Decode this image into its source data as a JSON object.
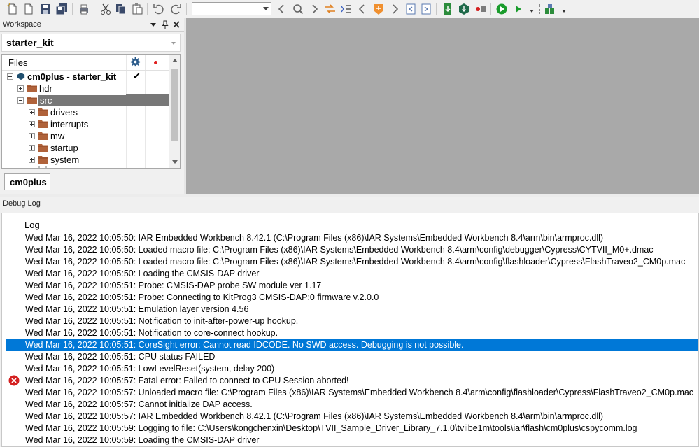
{
  "toolbar": {
    "icons": [
      "new-file-icon",
      "open-file-icon",
      "save-icon",
      "save-all-icon",
      "print-icon",
      "cut-icon",
      "copy-icon",
      "paste-icon",
      "undo-icon",
      "redo-icon",
      "find-back-icon",
      "find-icon",
      "find-forward-icon",
      "toggle-bookmark-icon",
      "go-to-icon",
      "navigate-back-icon",
      "bookmark-icon",
      "navigate-forward-icon",
      "compile-icon",
      "make-icon",
      "stop-build-icon",
      "breakpoint-icon",
      "download-debug-icon",
      "debug-no-download-icon",
      "layout-icon"
    ],
    "search_value": ""
  },
  "workspace": {
    "title": "Workspace",
    "project": "starter_kit",
    "files_header": "Files",
    "tree": [
      {
        "label": "cm0plus - starter_kit",
        "level": 0,
        "kind": "project",
        "bold": true,
        "check": "✔",
        "expander": "minus"
      },
      {
        "label": "hdr",
        "level": 1,
        "kind": "folder",
        "expander": "plus"
      },
      {
        "label": "src",
        "level": 1,
        "kind": "folder",
        "expander": "minus",
        "selected": true
      },
      {
        "label": "drivers",
        "level": 2,
        "kind": "folder",
        "expander": "plus"
      },
      {
        "label": "interrupts",
        "level": 2,
        "kind": "folder",
        "expander": "plus"
      },
      {
        "label": "mw",
        "level": 2,
        "kind": "folder",
        "expander": "plus"
      },
      {
        "label": "startup",
        "level": 2,
        "kind": "folder",
        "expander": "plus"
      },
      {
        "label": "system",
        "level": 2,
        "kind": "folder",
        "expander": "plus"
      }
    ],
    "tab": "cm0plus"
  },
  "debug_log": {
    "title": "Debug Log",
    "header": "Log",
    "lines": [
      {
        "text": "Wed Mar 16, 2022 10:05:50: IAR Embedded Workbench 8.42.1 (C:\\Program Files (x86)\\IAR Systems\\Embedded Workbench 8.4\\arm\\bin\\armproc.dll)"
      },
      {
        "text": "Wed Mar 16, 2022 10:05:50: Loaded macro file: C:\\Program Files (x86)\\IAR Systems\\Embedded Workbench 8.4\\arm\\config\\debugger\\Cypress\\CYTVII_M0+.dmac"
      },
      {
        "text": "Wed Mar 16, 2022 10:05:50: Loaded macro file: C:\\Program Files (x86)\\IAR Systems\\Embedded Workbench 8.4\\arm\\config\\flashloader\\Cypress\\FlashTraveo2_CM0p.mac"
      },
      {
        "text": "Wed Mar 16, 2022 10:05:50: Loading the CMSIS-DAP driver"
      },
      {
        "text": "Wed Mar 16, 2022 10:05:51: Probe: CMSIS-DAP probe SW module ver 1.17"
      },
      {
        "text": "Wed Mar 16, 2022 10:05:51: Probe: Connecting to KitProg3 CMSIS-DAP:0 firmware v.2.0.0"
      },
      {
        "text": "Wed Mar 16, 2022 10:05:51: Emulation layer version 4.56"
      },
      {
        "text": "Wed Mar 16, 2022 10:05:51: Notification to init-after-power-up hookup."
      },
      {
        "text": "Wed Mar 16, 2022 10:05:51: Notification to core-connect hookup."
      },
      {
        "text": "Wed Mar 16, 2022 10:05:51: CoreSight error: Cannot read IDCODE. No SWD access. Debugging is not possible.",
        "selected": true
      },
      {
        "text": "Wed Mar 16, 2022 10:05:51: CPU status FAILED"
      },
      {
        "text": "Wed Mar 16, 2022 10:05:51: LowLevelReset(system, delay 200)"
      },
      {
        "text": "Wed Mar 16, 2022 10:05:57: Fatal error: Failed to connect to CPU   Session aborted!",
        "error": true
      },
      {
        "text": "Wed Mar 16, 2022 10:05:57: Unloaded macro file: C:\\Program Files (x86)\\IAR Systems\\Embedded Workbench 8.4\\arm\\config\\flashloader\\Cypress\\FlashTraveo2_CM0p.mac"
      },
      {
        "text": "Wed Mar 16, 2022 10:05:57: Cannot initialize DAP access."
      },
      {
        "text": "Wed Mar 16, 2022 10:05:57: IAR Embedded Workbench 8.42.1 (C:\\Program Files (x86)\\IAR Systems\\Embedded Workbench 8.4\\arm\\bin\\armproc.dll)"
      },
      {
        "text": "Wed Mar 16, 2022 10:05:59: Logging to file: C:\\Users\\kongchenxin\\Desktop\\TVII_Sample_Driver_Library_7.1.0\\tviibe1m\\tools\\iar\\flash\\cm0plus\\cspycomm.log"
      },
      {
        "text": "Wed Mar 16, 2022 10:05:59: Loading the CMSIS-DAP driver"
      }
    ]
  },
  "colors": {
    "selection": "#0078d7",
    "tree_selection": "#777777",
    "folder": "#b0623a",
    "editor_bg": "#a9a9a9",
    "error": "#d42020"
  }
}
